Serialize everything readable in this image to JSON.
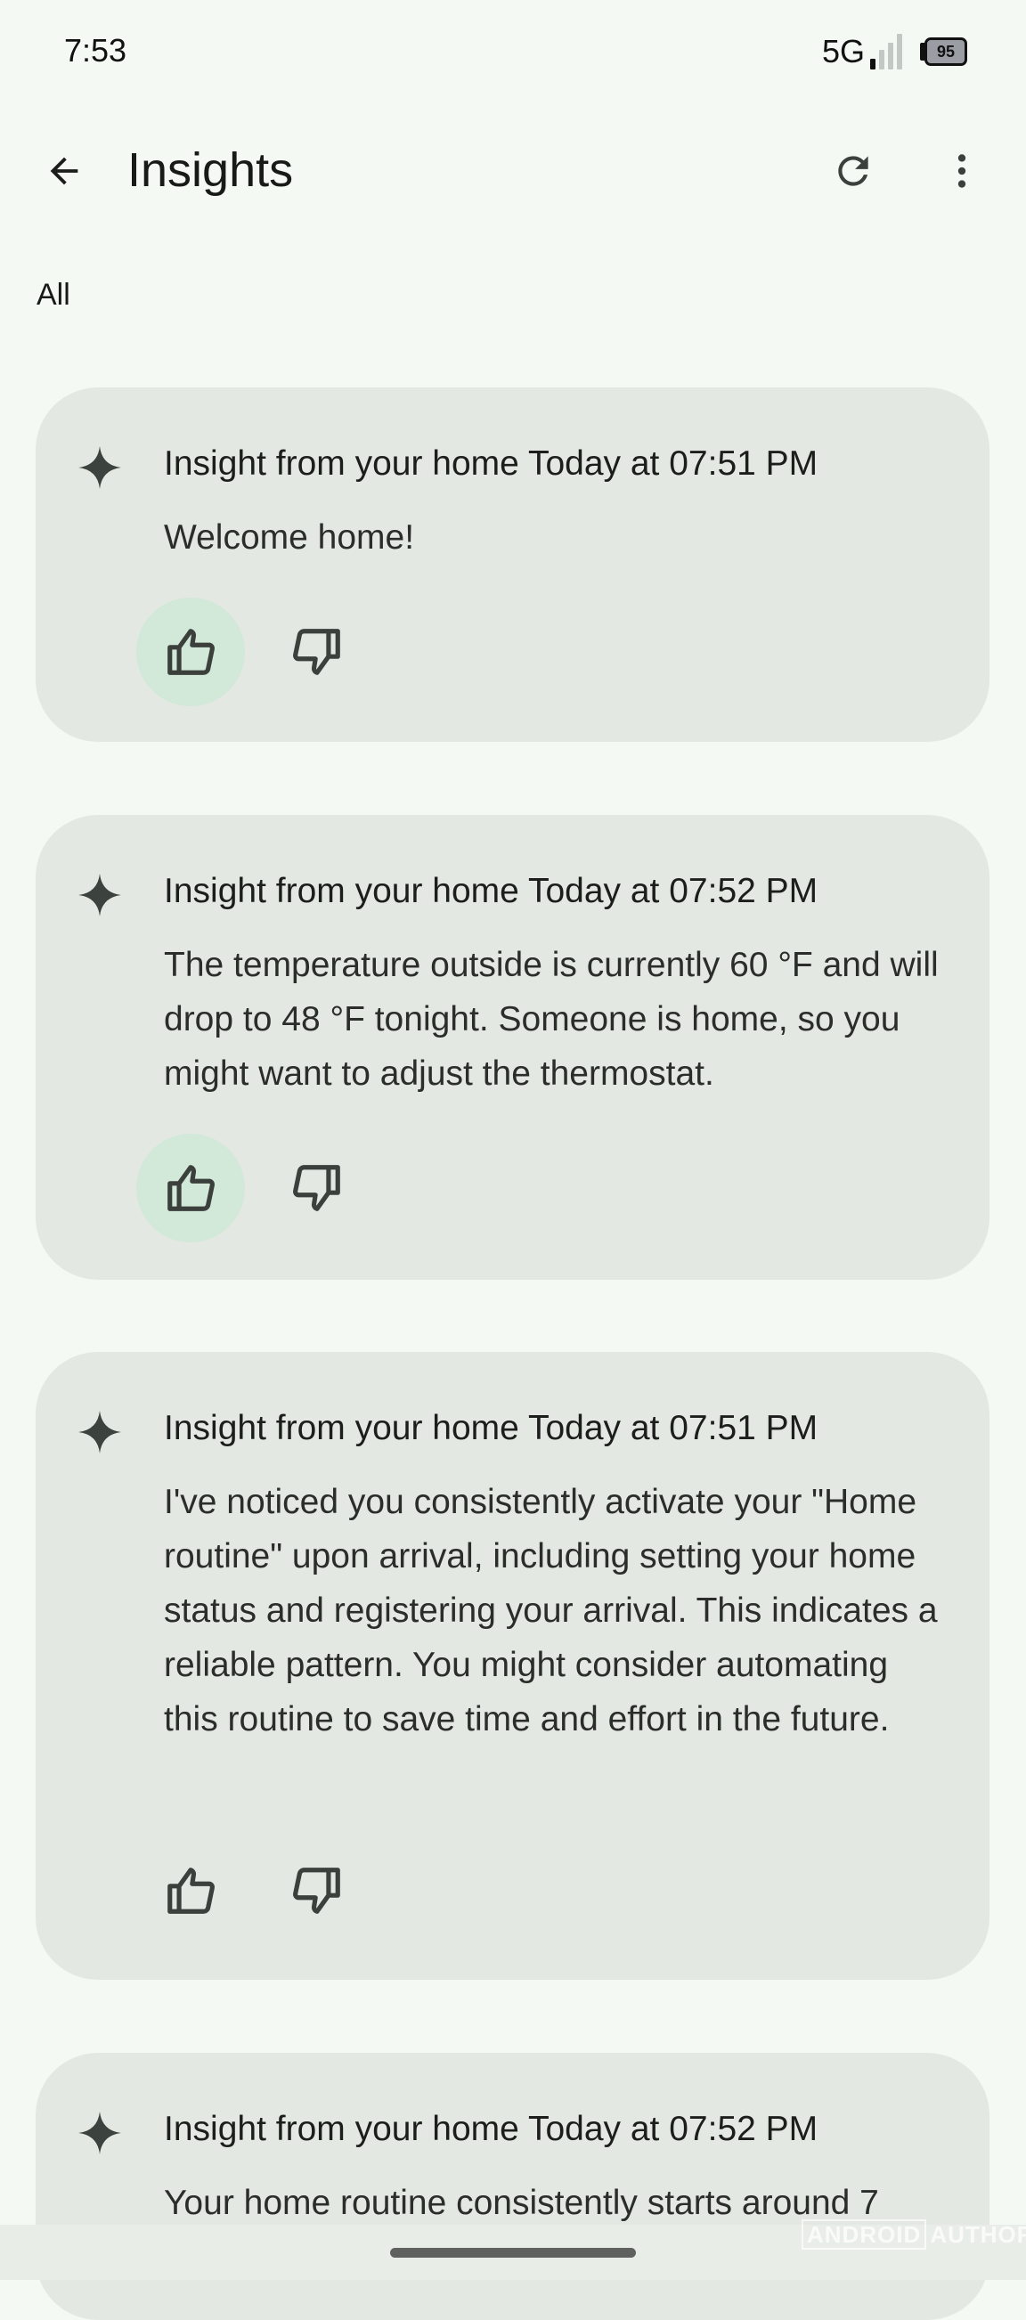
{
  "status_bar": {
    "time": "7:53",
    "network": "5G",
    "signal_bars_active": 1,
    "signal_bars_total": 4,
    "battery_level": "95"
  },
  "app_bar": {
    "back_icon": "arrow-back-icon",
    "title": "Insights",
    "refresh_icon": "refresh-icon",
    "more_icon": "more-vert-icon"
  },
  "filter": {
    "label": "All"
  },
  "insights": [
    {
      "title": "Insight from your home Today at 07:51 PM",
      "body": "Welcome home!",
      "thumbs_up_selected": true,
      "thumbs_down_selected": false
    },
    {
      "title": "Insight from your home Today at 07:52 PM",
      "body": "The temperature outside is currently 60 °F and will drop to 48 °F tonight. Someone is home, so you might want to adjust the thermostat.",
      "thumbs_up_selected": true,
      "thumbs_down_selected": false
    },
    {
      "title": "Insight from your home Today at 07:51 PM",
      "body": "I've noticed you consistently activate your \"Home routine\" upon arrival, including setting your home status and registering your arrival. This indicates a reliable pattern. You might consider automating this routine to save time and effort in the future.",
      "thumbs_up_selected": false,
      "thumbs_down_selected": false
    },
    {
      "title": "Insight from your home Today at 07:52 PM",
      "body": "Your home routine consistently starts around 7"
    }
  ],
  "watermark": {
    "part1": "ANDROID",
    "part2": "AUTHORITY"
  },
  "colors": {
    "background": "#f4f9f3",
    "card": "#e3e8e2",
    "selected_feedback": "#d2e8d8",
    "icon": "#3c403c"
  }
}
